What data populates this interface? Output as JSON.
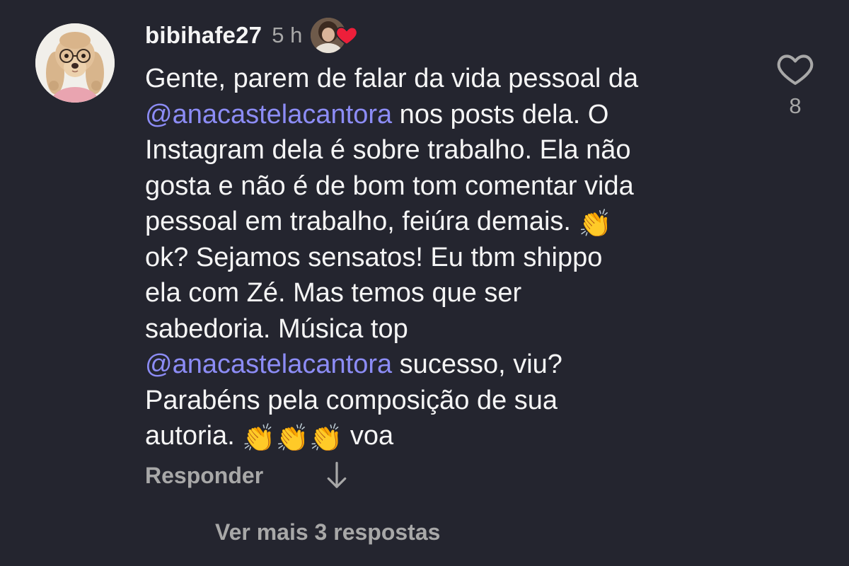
{
  "comment": {
    "username": "bibihafe27",
    "timestamp": "5 h",
    "liked_by_creator_icon": "heart-icon",
    "avatar_icon": "poodle-avatar",
    "text_part1": "Gente, parem de falar da vida pessoal da\n",
    "mention1": "@anacastelacantora",
    "text_part2": " nos posts dela. O\nInstagram dela é sobre trabalho. Ela não\ngosta e não é de bom tom comentar vida\npessoal em trabalho, feiúra demais. ",
    "emoji1": "👏",
    "text_part3": "\nok? Sejamos sensatos! Eu tbm shippo\nela com Zé. Mas temos que ser\nsabedoria.  Música top\n",
    "mention2": "@anacastelacantora",
    "text_part4": " sucesso, viu?\nParabéns pela composição de sua\nautoria. ",
    "emoji2": "👏👏👏",
    "text_part5": " voa",
    "like_count": "8",
    "reply_label": "Responder",
    "view_more_replies": "Ver mais 3 respostas"
  },
  "colors": {
    "background": "#24252f",
    "text": "#f5f5f5",
    "secondary_text": "#a8a8a8",
    "mention": "#8c8cf5",
    "heart_red": "#ed1f3a"
  }
}
